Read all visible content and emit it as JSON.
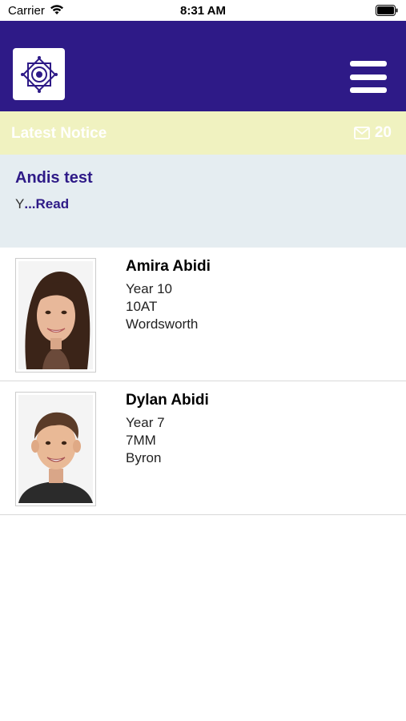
{
  "status_bar": {
    "carrier": "Carrier",
    "time": "8:31 AM",
    "wifi_icon": "wifi-icon",
    "battery_icon": "battery-icon"
  },
  "header": {
    "background": "#2e1a87",
    "logo_icon": "school-crest-icon",
    "menu_icon": "hamburger-menu-icon"
  },
  "notice_bar": {
    "title": "Latest Notice",
    "count": "20",
    "icon": "mail-icon",
    "background": "#f0f2c0"
  },
  "notice": {
    "heading": "Andis test",
    "body_text": "Y",
    "read_label": "...Read",
    "background": "#e5edf1"
  },
  "students": [
    {
      "name": "Amira Abidi",
      "year": "Year 10",
      "form": "10AT",
      "house": "Wordsworth"
    },
    {
      "name": "Dylan Abidi",
      "year": "Year 7",
      "form": "7MM",
      "house": "Byron"
    }
  ],
  "colors": {
    "accent": "#2e1a87",
    "white": "#ffffff"
  }
}
